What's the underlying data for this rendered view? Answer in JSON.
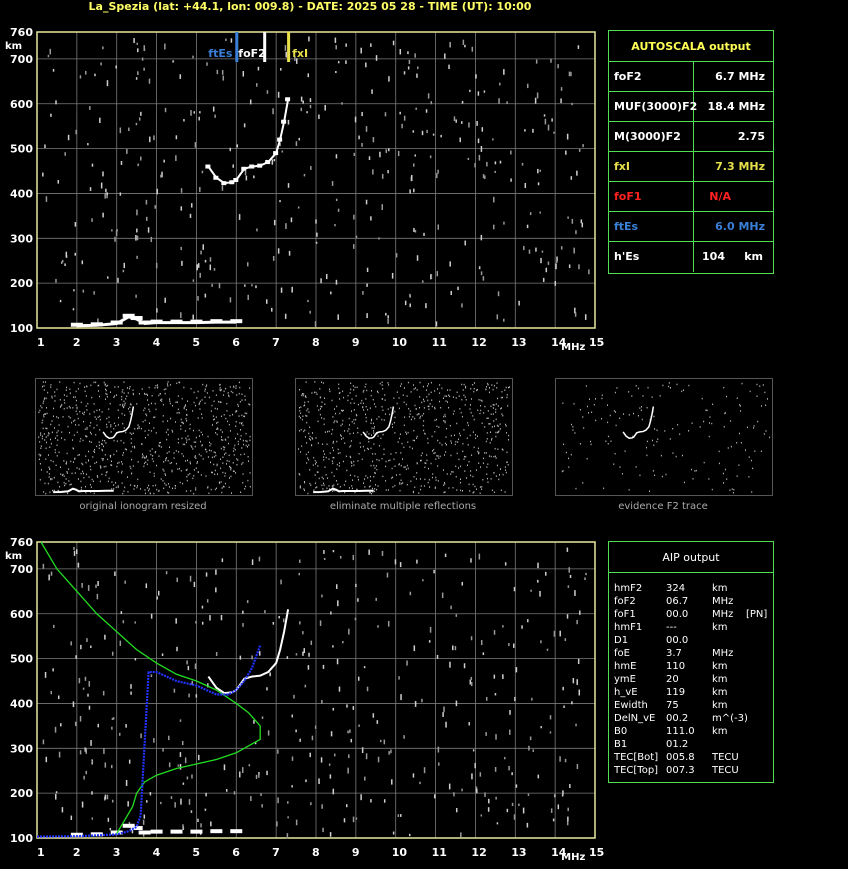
{
  "title": "La_Spezia (lat: +44.1, lon: 009.8) - DATE: 2025 05 28 - TIME (UT): 10:00",
  "colors": {
    "grid": "#7a7a7a",
    "frame": "#e8e8a0",
    "trace": "#ffffff",
    "profile": "#22dd22",
    "aip_trace": "#2233ff",
    "ftEs": "#3a7fd8",
    "fxI": "#e8e04a",
    "foF1": "#ff2020",
    "green_box": "#4fe04f",
    "header": "#ffff55"
  },
  "axes": {
    "x_ticks": [
      "1",
      "2",
      "3",
      "4",
      "5",
      "6",
      "7",
      "8",
      "9",
      "10",
      "11",
      "12",
      "13",
      "14",
      "15"
    ],
    "x_unit": "MHz",
    "y_ticks": [
      "760",
      "700",
      "600",
      "500",
      "400",
      "300",
      "200",
      "100"
    ],
    "y_unit": "km"
  },
  "markers": {
    "ftEs": "ftEs",
    "foF2": "foF2",
    "fxI": "fxI"
  },
  "autoscala": {
    "header": "AUTOSCALA output",
    "rows": [
      {
        "label": "foF2",
        "value": "6.7 MHz",
        "color": "#ffffff"
      },
      {
        "label": "MUF(3000)F2",
        "value": "18.4 MHz",
        "color": "#ffffff"
      },
      {
        "label": "M(3000)F2",
        "value": "2.75",
        "color": "#ffffff"
      },
      {
        "label": "fxI",
        "value": "7.3 MHz",
        "color": "#e8e04a"
      },
      {
        "label": "foF1",
        "value": "N/A",
        "color": "#ff2020"
      },
      {
        "label": "ftEs",
        "value": "6.0 MHz",
        "color": "#3a7fd8"
      },
      {
        "label": "h'Es",
        "value": "104",
        "unit": "km",
        "color": "#ffffff"
      }
    ]
  },
  "thumbnails": {
    "captions": [
      "original ionogram resized",
      "eliminate multiple reflections",
      "evidence F2 trace"
    ]
  },
  "aip": {
    "header": "AIP output",
    "rows": [
      {
        "k": "hmF2",
        "v": "324",
        "u": "km"
      },
      {
        "k": "foF2",
        "v": "06.7",
        "u": "MHz"
      },
      {
        "k": "foF1",
        "v": "00.0",
        "u": "MHz",
        "x": "[PN]"
      },
      {
        "k": "hmF1",
        "v": "---",
        "u": "km"
      },
      {
        "k": "D1",
        "v": "00.0",
        "u": ""
      },
      {
        "k": "foE",
        "v": "3.7",
        "u": "MHz"
      },
      {
        "k": "hmE",
        "v": "110",
        "u": "km"
      },
      {
        "k": "ymE",
        "v": "20",
        "u": "km"
      },
      {
        "k": "h_vE",
        "v": "119",
        "u": "km"
      },
      {
        "k": "Ewidth",
        "v": "75",
        "u": "km"
      },
      {
        "k": "DelN_vE",
        "v": "00.2",
        "u": "m^(-3)"
      },
      {
        "k": "B0",
        "v": "111.0",
        "u": "km"
      },
      {
        "k": "B1",
        "v": "01.2",
        "u": ""
      },
      {
        "k": "TEC[Bot]",
        "v": "005.8",
        "u": "TECU"
      },
      {
        "k": "TEC[Top]",
        "v": "007.3",
        "u": "TECU"
      }
    ]
  },
  "chart_data": [
    {
      "type": "scatter",
      "title": "",
      "xlabel": "MHz",
      "ylabel": "km",
      "xlim": [
        1,
        15
      ],
      "ylim": [
        100,
        760
      ],
      "grid": true,
      "series": [
        {
          "values_x": [
            2.0,
            2.5,
            3.0,
            3.3,
            3.5,
            3.7,
            4.0,
            4.5,
            5.0,
            5.5,
            6.0
          ],
          "values_y": [
            105,
            106,
            110,
            125,
            120,
            110,
            112,
            112,
            112,
            113,
            113
          ]
        },
        {
          "values_x": [
            5.3,
            5.5,
            5.7,
            5.9,
            6.0,
            6.2,
            6.4,
            6.6,
            6.8,
            7.0,
            7.1,
            7.2,
            7.3
          ],
          "values_y": [
            460,
            435,
            423,
            425,
            430,
            455,
            460,
            462,
            470,
            490,
            520,
            560,
            610
          ]
        }
      ]
    },
    {
      "type": "line",
      "title": "",
      "xlabel": "MHz",
      "ylabel": "km",
      "xlim": [
        1,
        15
      ],
      "ylim": [
        100,
        760
      ],
      "grid": true,
      "series": [
        {
          "values_x": [
            1.1,
            1.5,
            2.0,
            2.5,
            3.0,
            3.5,
            4.0,
            4.5,
            5.0,
            5.5,
            6.0,
            6.3,
            6.6,
            6.6,
            6.3,
            6.0,
            5.5,
            5.0,
            4.5,
            4.0,
            3.7,
            3.5,
            3.4,
            3.2,
            3.0
          ],
          "values_y": [
            760,
            700,
            650,
            600,
            560,
            520,
            490,
            465,
            450,
            430,
            400,
            380,
            350,
            320,
            305,
            290,
            275,
            265,
            255,
            240,
            225,
            200,
            170,
            140,
            110
          ]
        },
        {
          "values_x": [
            1.0,
            2.0,
            3.0,
            3.3,
            3.5,
            3.6,
            3.8,
            4.0,
            4.5,
            5.0,
            5.5,
            5.8,
            6.0,
            6.2,
            6.4,
            6.6
          ],
          "values_y": [
            103,
            104,
            108,
            115,
            125,
            150,
            470,
            470,
            450,
            440,
            420,
            420,
            430,
            450,
            480,
            530
          ]
        }
      ]
    }
  ]
}
